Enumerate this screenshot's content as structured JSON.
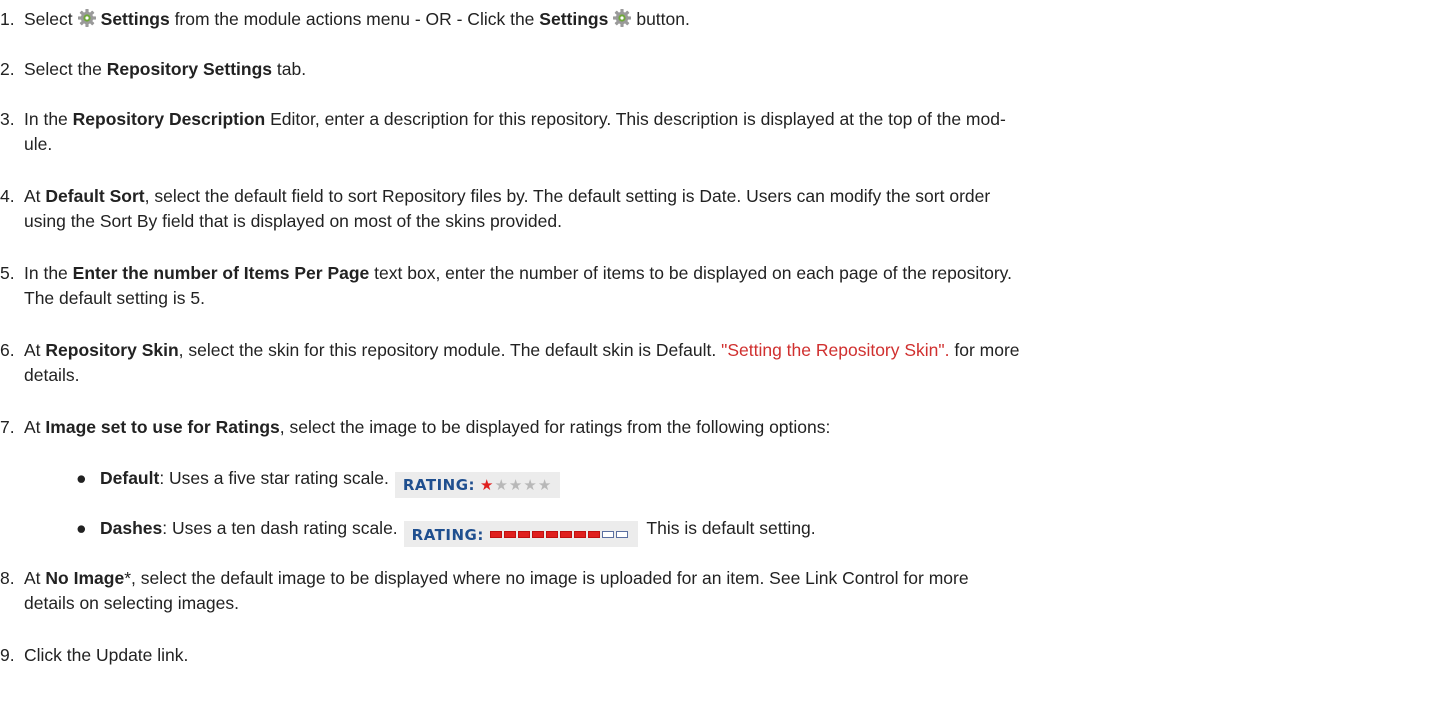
{
  "steps": [
    {
      "num": "1.",
      "select": "Select",
      "settings": "Settings",
      "mid": "from the module actions menu - OR - Click the",
      "settings2": "Settings",
      "end": "button."
    },
    {
      "num": "2.",
      "pre": "Select the",
      "bold": "Repository Settings",
      "post": "tab."
    },
    {
      "num": "3.",
      "pre": "In the",
      "bold": "Repository Description",
      "post": "Editor, enter a description for this repository. This description is displayed at the top of the mod-",
      "line2": "ule."
    },
    {
      "num": "4.",
      "pre": "At",
      "bold": "Default Sort",
      "post": ", select the default field to sort Repository files by. The default setting is Date. Users can modify the sort order",
      "line2": "using the Sort By field that is displayed on most of the skins provided."
    },
    {
      "num": "5.",
      "pre": "In the",
      "bold": "Enter the number of Items Per Page",
      "post": "text box, enter the number of items to be displayed on each page of the repository.",
      "line2": "The default setting is 5."
    },
    {
      "num": "6.",
      "pre": "At",
      "bold": "Repository Skin",
      "post": ", select the skin for this repository module. The default skin is Default.",
      "link": "\"Setting the Repository Skin\".",
      "post2": "for more",
      "line2": "details."
    },
    {
      "num": "7.",
      "pre": "At",
      "bold": "Image set to use for Ratings",
      "post": ", select the image to be displayed for ratings from the following options:"
    },
    {
      "num": "8.",
      "pre": "At",
      "bold": "No Image",
      "post": "*, select the default image to be displayed where no image is uploaded for an item. See Link Control for more",
      "line2": "details on selecting images."
    },
    {
      "num": "9.",
      "text": "Click the Update link."
    }
  ],
  "bullets": [
    {
      "dot": "●",
      "bold": "Default",
      "text": ": Uses a five star rating scale.",
      "rating_label": "RATING:",
      "stars_on": "★",
      "stars_off": "★★★★",
      "rating_value": 1,
      "rating_max": 5
    },
    {
      "dot": "●",
      "bold": "Dashes",
      "text": ": Uses a ten dash rating scale.",
      "rating_label": "RATING:",
      "after": "This is default setting.",
      "rating_value": 8,
      "rating_max": 10
    }
  ],
  "colors": {
    "link": "#d0302f",
    "rating_label": "#1f4f8f",
    "rating_on": "#e0201e",
    "rating_off": "#b8b8b8",
    "icon": "gear-icon"
  }
}
